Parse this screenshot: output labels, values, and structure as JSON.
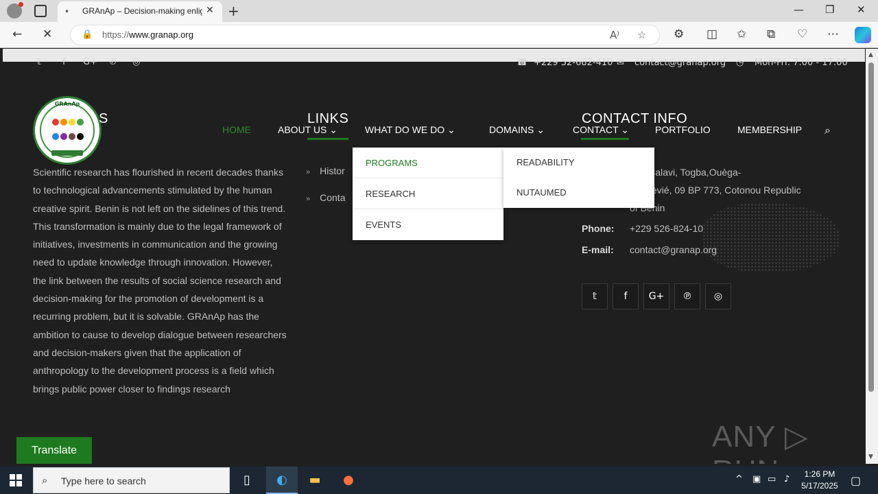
{
  "browser": {
    "tab_title": "GRAnAp – Decision-making enlig",
    "url_proto": "https://",
    "url_host": "www.granap.org",
    "icons": [
      "profile-icon",
      "tabs-icon",
      "close-icon",
      "new-tab-icon",
      "back-icon",
      "stop-icon",
      "lock-icon",
      "read-aloud-icon",
      "favorite-icon",
      "extensions-icon",
      "split-screen-icon",
      "favorites-icon",
      "collections-icon",
      "performance-icon",
      "more-icon",
      "copilot-icon"
    ],
    "tab_glyph": "•",
    "close_glyph": "✕",
    "plus_glyph": "+",
    "back_glyph": "←",
    "stop_glyph": "✕",
    "lock_glyph": "🔒",
    "minimize_glyph": "—",
    "restore_glyph": "❐",
    "winclose_glyph": "✕",
    "read_glyph": "A⁾",
    "star_glyph": "☆",
    "ext_glyph": "⚙",
    "split_glyph": "◫",
    "favs_glyph": "✩",
    "coll_glyph": "⧉",
    "perf_glyph": "♡",
    "more_glyph": "⋯"
  },
  "topbar": {
    "social": [
      "𝕥",
      "f",
      "G+",
      "℗",
      "◎"
    ],
    "phone_icon": "☎",
    "phone": "+229 52-682-410",
    "mail_icon": "✉",
    "email": "contact@granap.org",
    "clock_icon": "◷",
    "hours": "Mon-Fri: 7:00 - 17:00"
  },
  "logo": {
    "arc_text": "GRAnAp",
    "colors": [
      "#e53935",
      "#fb8c00",
      "#fdd835",
      "#43a047",
      "#1e88e5",
      "#8e24aa",
      "#6d4c41",
      "#000000"
    ]
  },
  "sections": {
    "about_partial": "S",
    "links": "LINKS",
    "contact_info": "CONTACT INFO"
  },
  "nav": {
    "home": "HOME",
    "about": "ABOUT US",
    "what": "WHAT DO WE DO",
    "domains": "DOMAINS",
    "contact": "CONTACT",
    "portfolio": "PORTFOLIO",
    "membership": "MEMBERSHIP",
    "caret": "⌄",
    "search_glyph": "⌕",
    "active_color": "#2e8b2e",
    "underline_color": "#1e7a1e"
  },
  "dropdown_what": [
    "PROGRAMS",
    "RESEARCH",
    "EVENTS"
  ],
  "dropdown_domains": [
    "READABILITY",
    "NUTAUMED"
  ],
  "about": {
    "text": "Scientific research has flourished in recent decades thanks to technological advancements stimulated by the human creative spirit. Benin is not left on the sidelines of this trend. This transformation is mainly due to the legal framework of initiatives, investments in communication and the growing need to update knowledge through innovation. However, the link between the results of social science research and decision-making for the promotion of development is a recurring problem, but it is solvable. GRAnAp has the ambition to cause to develop dialogue between researchers and decision-makers given that the application of anthropology to the development process is a field which brings public power closer to findings research"
  },
  "links": {
    "chev": "»",
    "item1": "Histor",
    "item2": "Conta"
  },
  "contact": {
    "address": "ney-Calavi, Togba,Ouèga-\nHossèvié, 09 BP 773, Cotonou Republic\nof Benin",
    "phone_label": "Phone:",
    "phone": "+229 526-824-10",
    "email_label": "E-mail:",
    "email": "contact@granap.org",
    "social": [
      "𝕥",
      "f",
      "G+",
      "℗",
      "◎"
    ]
  },
  "translate": "Translate",
  "watermark": "ANY ▷ RUN",
  "taskbar": {
    "search_placeholder": "Type here to search",
    "search_glyph": "⌕",
    "taskview_glyph": "▯",
    "edge_glyph": "◐",
    "explorer_glyph": "▬",
    "firefox_glyph": "●",
    "time": "1:26 PM",
    "date": "5/17/2025",
    "tray_up": "^",
    "tray_net": "▭",
    "tray_vol": "♪",
    "tray_msg": "▢"
  },
  "colors": {
    "brand_green": "#1e7a1e",
    "page_bg": "#1f1f1f",
    "taskbar_bg": "#1c2733"
  }
}
